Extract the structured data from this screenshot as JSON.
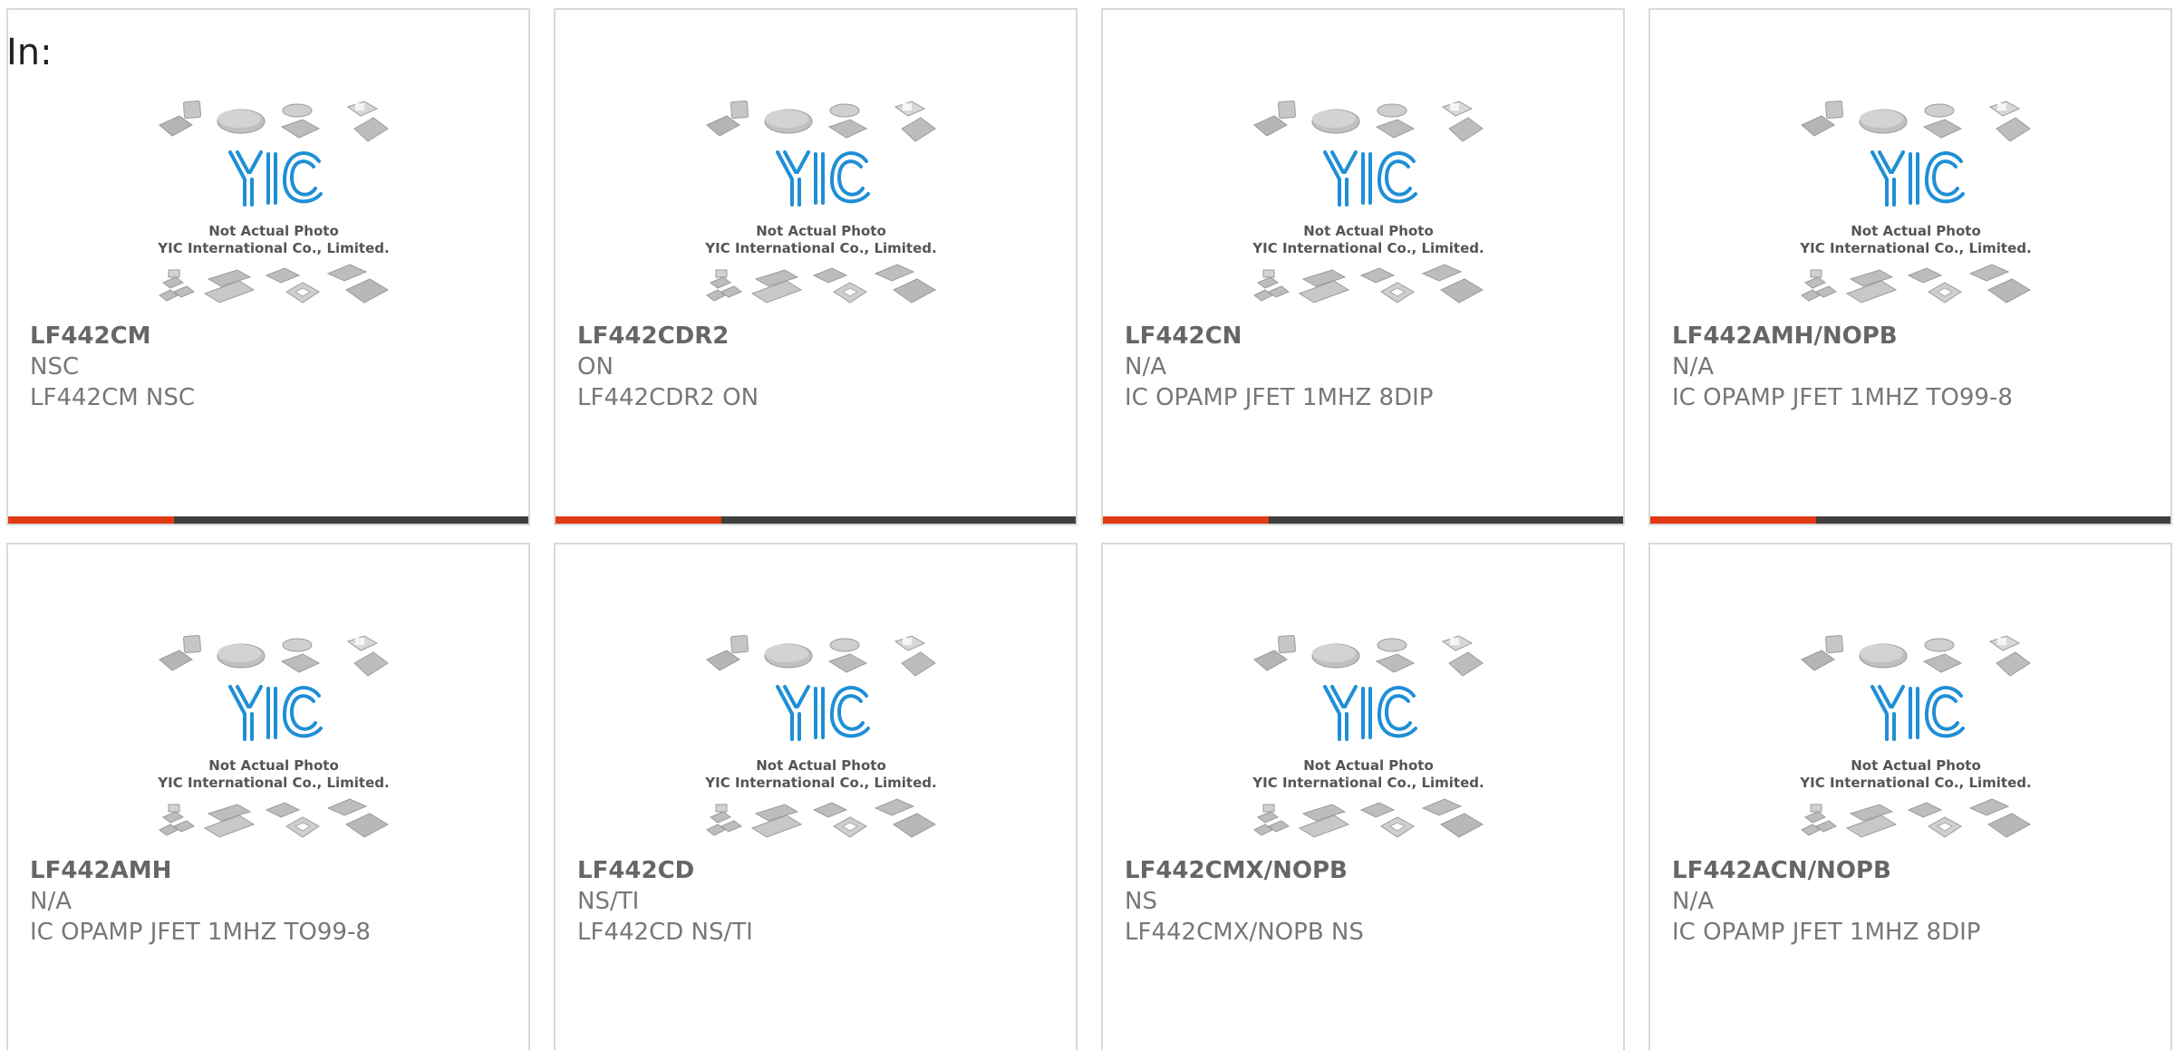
{
  "page": {
    "label": "In:"
  },
  "placeholder_image": {
    "logo_text": "YIC",
    "line1": "Not Actual Photo",
    "line2": "YIC International Co., Limited."
  },
  "colors": {
    "accent": "#e23a12",
    "bar_dark": "#3f3f3f",
    "card_border": "#d9d9d9",
    "logo_blue": "#1f8fd6",
    "text_gray": "#777777"
  },
  "products": [
    {
      "part": "LF442CM",
      "brand": "NSC",
      "description": "LF442CM NSC"
    },
    {
      "part": "LF442CDR2",
      "brand": "ON",
      "description": "LF442CDR2 ON"
    },
    {
      "part": "LF442CN",
      "brand": "N/A",
      "description": "IC OPAMP JFET 1MHZ 8DIP"
    },
    {
      "part": "LF442AMH/NOPB",
      "brand": "N/A",
      "description": "IC OPAMP JFET 1MHZ TO99-8"
    },
    {
      "part": "LF442AMH",
      "brand": "N/A",
      "description": "IC OPAMP JFET 1MHZ TO99-8"
    },
    {
      "part": "LF442CD",
      "brand": "NS/TI",
      "description": "LF442CD NS/TI"
    },
    {
      "part": "LF442CMX/NOPB",
      "brand": "NS",
      "description": "LF442CMX/NOPB NS"
    },
    {
      "part": "LF442ACN/NOPB",
      "brand": "N/A",
      "description": "IC OPAMP JFET 1MHZ 8DIP"
    }
  ]
}
